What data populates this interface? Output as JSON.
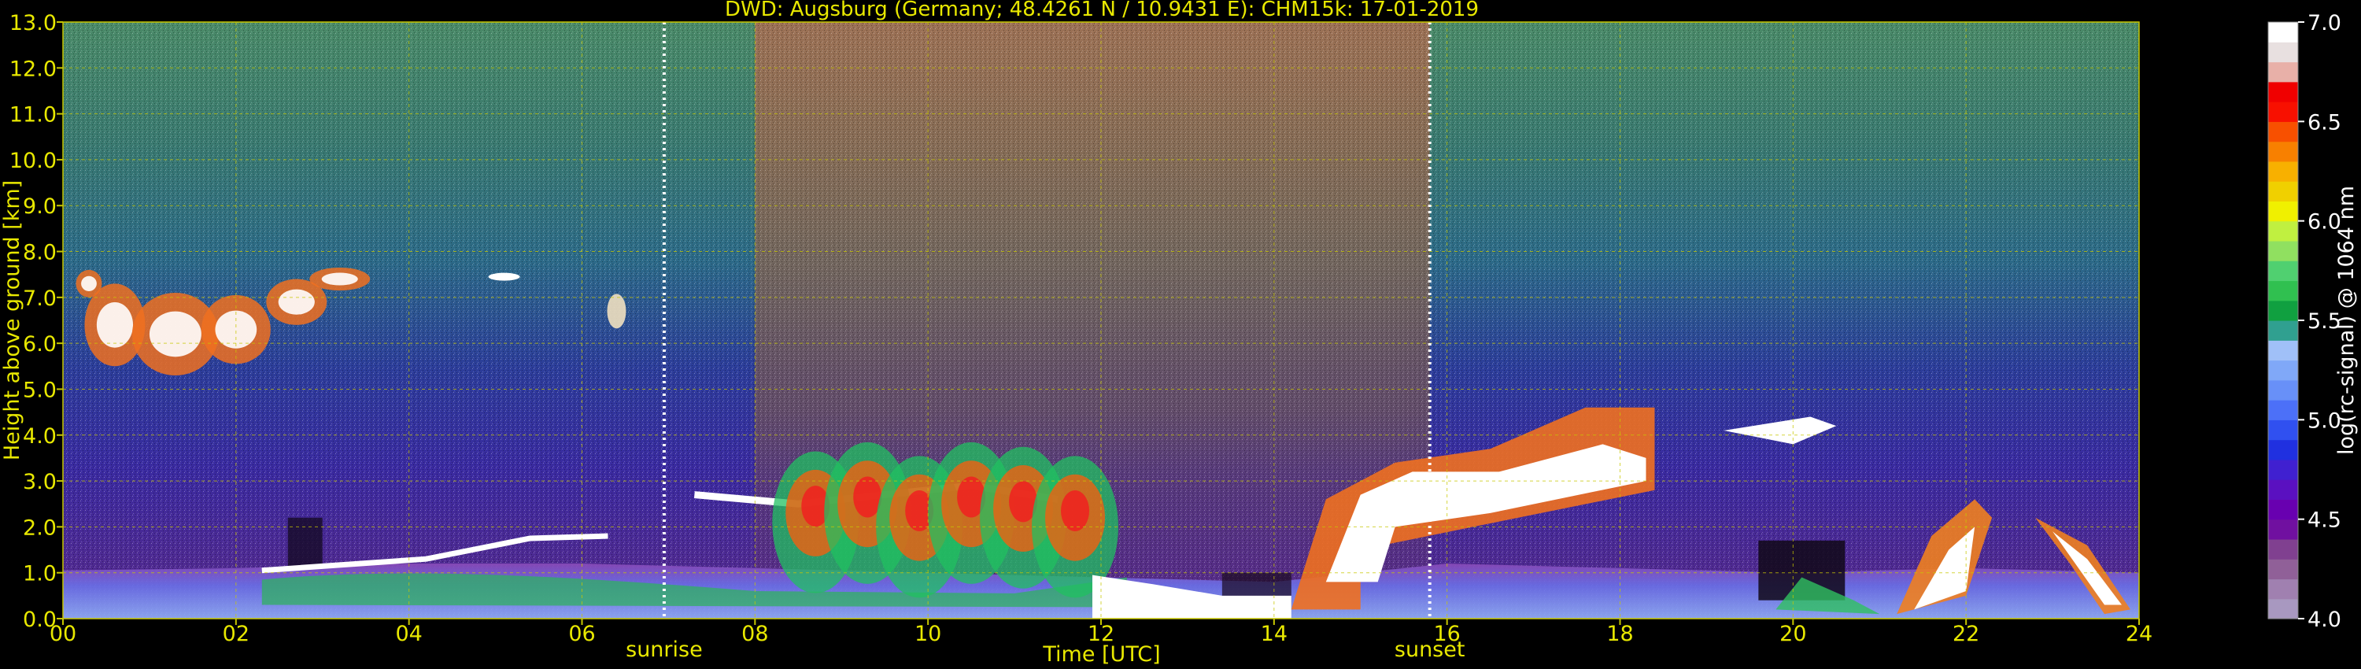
{
  "chart_data": {
    "type": "heatmap",
    "title": "DWD: Augsburg (Germany; 48.4261 N / 10.9431 E):    CHM15k: 17-01-2019",
    "xlabel": "Time [UTC]",
    "ylabel": "Height above ground [km]",
    "xlim": [
      0,
      24
    ],
    "ylim": [
      0,
      13
    ],
    "x_ticks": [
      0,
      2,
      4,
      6,
      8,
      10,
      12,
      14,
      16,
      18,
      20,
      22,
      24
    ],
    "x_tick_labels": [
      "00",
      "02",
      "04",
      "06",
      "08",
      "10",
      "12",
      "14",
      "16",
      "18",
      "20",
      "22",
      "24"
    ],
    "y_ticks": [
      0,
      1,
      2,
      3,
      4,
      5,
      6,
      7,
      8,
      9,
      10,
      11,
      12,
      13
    ],
    "y_tick_labels": [
      "0.0",
      "1.0",
      "2.0",
      "3.0",
      "4.0",
      "5.0",
      "6.0",
      "7.0",
      "8.0",
      "9.0",
      "10.0",
      "11.0",
      "12.0",
      "13.0"
    ],
    "grid": true,
    "markers": [
      {
        "label": "sunrise",
        "time": 6.95
      },
      {
        "label": "sunset",
        "time": 15.8
      }
    ],
    "colorbar": {
      "label": "log(rc-signal) @ 1064 nm",
      "range": [
        4.0,
        7.0
      ],
      "tick_values": [
        4.0,
        4.5,
        5.0,
        5.5,
        6.0,
        6.5,
        7.0
      ],
      "tick_labels": [
        "4.0",
        "4.5",
        "5.0",
        "5.5",
        "6.0",
        "6.5",
        "7.0"
      ],
      "colors": [
        "#a898c0",
        "#a080b0",
        "#906098",
        "#804090",
        "#7010a0",
        "#6800b0",
        "#5a10c0",
        "#4020d0",
        "#2030e0",
        "#3050f0",
        "#4c70f8",
        "#6890f8",
        "#80a8f8",
        "#a0c0f8",
        "#30a090",
        "#10a040",
        "#30c050",
        "#50d070",
        "#90e060",
        "#c0f040",
        "#f0f000",
        "#f0d000",
        "#f8b000",
        "#f88000",
        "#f85000",
        "#f81000",
        "#f00000",
        "#e8b0a8",
        "#e8e0e0",
        "#ffffff"
      ]
    },
    "features": [
      {
        "kind": "cirrus",
        "t0": 0.3,
        "t1": 3.6,
        "h0": 5.3,
        "h1": 7.8
      },
      {
        "kind": "boundary-layer",
        "t0": 0,
        "t1": 24,
        "h0": 0,
        "h1": 1.2
      },
      {
        "kind": "cloud-top-line",
        "t0": 2.2,
        "t1": 8.0,
        "h0": 1.0,
        "h1": 2.7
      },
      {
        "kind": "stratocumulus",
        "t0": 8.0,
        "t1": 12.5,
        "h0": 1.0,
        "h1": 3.2
      },
      {
        "kind": "low-cloud",
        "t0": 11.8,
        "t1": 14.2,
        "h0": 0,
        "h1": 1.0
      },
      {
        "kind": "altostratus",
        "t0": 14.2,
        "t1": 18.5,
        "h0": 0.5,
        "h1": 4.8
      },
      {
        "kind": "precip-streaks",
        "t0": 19.8,
        "t1": 24,
        "h0": 0,
        "h1": 2.9
      }
    ]
  }
}
